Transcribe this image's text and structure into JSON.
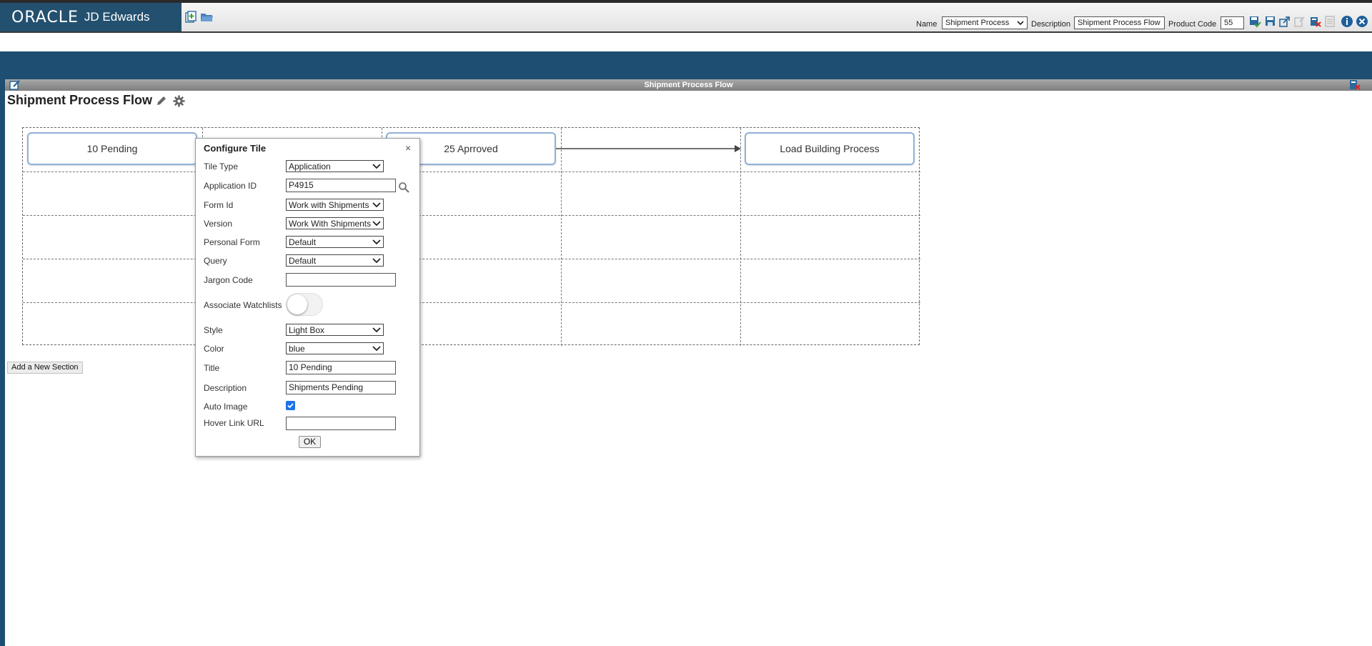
{
  "header": {
    "brand_oracle": "ORACLE",
    "brand_jde": "JD Edwards",
    "name_label": "Name",
    "name_value": "Shipment Process",
    "description_label": "Description",
    "description_value": "Shipment Process Flow",
    "product_code_label": "Product Code",
    "product_code_value": "55"
  },
  "panel": {
    "title": "Shipment Process Flow"
  },
  "page": {
    "title": "Shipment Process Flow",
    "add_section_label": "Add a New Section"
  },
  "tiles": [
    {
      "label": "10 Pending"
    },
    {
      "label": "25 Aprroved"
    },
    {
      "label": "Load Building Process"
    }
  ],
  "dialog": {
    "title": "Configure Tile",
    "close_glyph": "×",
    "fields": {
      "tile_type": {
        "label": "Tile Type",
        "value": "Application"
      },
      "application_id": {
        "label": "Application ID",
        "value": "P4915"
      },
      "form_id": {
        "label": "Form Id",
        "value": "Work with Shipments"
      },
      "version": {
        "label": "Version",
        "value": "Work With Shipments"
      },
      "personal_form": {
        "label": "Personal Form",
        "value": "Default"
      },
      "query": {
        "label": "Query",
        "value": "Default"
      },
      "jargon_code": {
        "label": "Jargon Code",
        "value": ""
      },
      "associate_watchlists": {
        "label": "Associate Watchlists"
      },
      "style": {
        "label": "Style",
        "value": "Light Box"
      },
      "color": {
        "label": "Color",
        "value": "blue"
      },
      "title": {
        "label": "Title",
        "value": "10 Pending"
      },
      "description": {
        "label": "Description",
        "value": "Shipments Pending"
      },
      "auto_image": {
        "label": "Auto Image",
        "checked": true
      },
      "hover_link_url": {
        "label": "Hover Link URL",
        "value": ""
      }
    },
    "ok_label": "OK"
  },
  "colors": {
    "brand_blue": "#23506f",
    "band_blue": "#1e4e71",
    "tile_border": "#8fb1d8",
    "checkbox_blue": "#1a73e8"
  }
}
